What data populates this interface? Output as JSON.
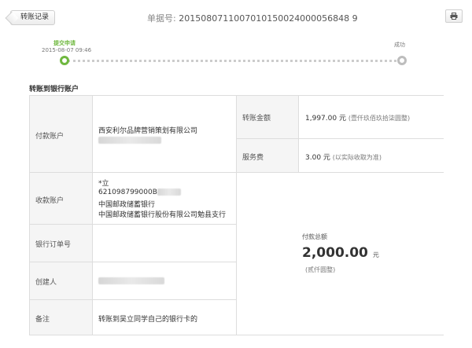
{
  "header": {
    "back_label": "转账记录",
    "bill_label": "单据号:",
    "bill_number": "2015080711007010150024000056848 9",
    "print_icon": "printer-icon"
  },
  "progress": {
    "step_start": "提交申请",
    "step_start_time": "2015-08-07 09:46",
    "step_end": "成功"
  },
  "section": {
    "title": "转账到银行账户"
  },
  "payer": {
    "label": "付款账户",
    "name": "西安利尔品牌营销策划有限公司"
  },
  "amount": {
    "label": "转账金额",
    "value": "1,997.00 元",
    "chinese": "(壹仟玖佰玖拾柒圆整)"
  },
  "fee": {
    "label": "服务费",
    "value": "3.00 元",
    "note": "(以实际收取为准)"
  },
  "payee": {
    "label": "收款账户",
    "name": "*立",
    "account": "621098799000B",
    "bank": "中国邮政储蓄银行",
    "branch": "中国邮政储蓄银行股份有限公司勉县支行"
  },
  "order": {
    "label": "银行订单号"
  },
  "creator": {
    "label": "创建人"
  },
  "remark": {
    "label": "备注",
    "value": "转账到吴立同学自己的银行卡的"
  },
  "total": {
    "label": "付款总额",
    "value": "2,000.00",
    "unit": "元",
    "chinese": "(贰仟圆整)"
  },
  "colors": {
    "accent_green": "#6fb83f",
    "border": "#dddddd",
    "label_bg": "#f5f5f5"
  }
}
